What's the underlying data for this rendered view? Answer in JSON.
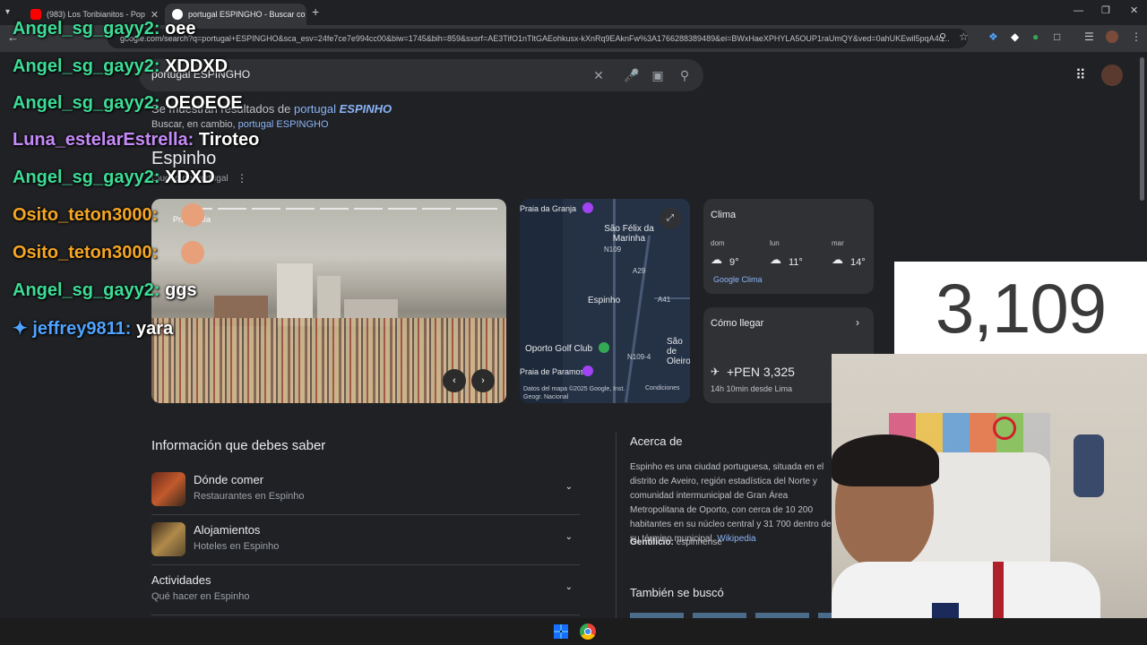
{
  "browser": {
    "tabs": [
      {
        "title": "(983) Los Toribianitos - Pop",
        "active": false
      },
      {
        "title": "portugal ESPINGHO - Buscar co",
        "active": true
      }
    ],
    "new_tab": "+",
    "url": "google.com/search?q=portugal+ESPINGHO&sca_esv=24fe7ce7e994cc00&biw=1745&bih=859&sxsrf=AE3TifO1nTltGAEohkusx-kXnRq9EAknFw%3A1766288389489&ei=BWxHaeXPHYLA5OUP1raUmQY&ved=0ahUKEwil5pqA4c..."
  },
  "search": {
    "query": "portugal ESPINGHO"
  },
  "correction": {
    "prefix": "Se muestran resultados de",
    "term_plain": "portugal",
    "term_bold": "ESPINHO",
    "instead_prefix": "Buscar, en cambio,",
    "instead_link": "portugal ESPINGHO"
  },
  "entity": {
    "title": "Espinho",
    "subtitle": "Ciudad de Portugal"
  },
  "photo": {
    "caption": "Praia Baía"
  },
  "map": {
    "labels": [
      "Praia da Granja",
      "São Félix da Marinha",
      "Espinho",
      "Oporto Golf Club",
      "Praia de Paramos",
      "São de Oleiros"
    ],
    "roads": [
      "N109",
      "A29",
      "A41",
      "N109-4"
    ],
    "credit": "Datos del mapa ©2025 Google, Inst. Geogr. Nacional",
    "terms": "Condiciones"
  },
  "weather": {
    "title": "Clima",
    "days": [
      {
        "day": "dom",
        "temp": "9°"
      },
      {
        "day": "lun",
        "temp": "11°"
      },
      {
        "day": "mar",
        "temp": "14°"
      }
    ],
    "source": "Google Clima"
  },
  "directions": {
    "title": "Cómo llegar",
    "price": "+PEN 3,325",
    "duration": "14h 10min desde Lima"
  },
  "info": {
    "title": "Información que debes saber",
    "rows": [
      {
        "title": "Dónde comer",
        "subtitle": "Restaurantes en Espinho"
      },
      {
        "title": "Alojamientos",
        "subtitle": "Hoteles en Espinho"
      },
      {
        "title": "Actividades",
        "subtitle": "Qué hacer en Espinho"
      }
    ]
  },
  "about": {
    "title": "Acerca de",
    "body": "Espinho es una ciudad portuguesa, situada en el distrito de Aveiro, región estadística del Norte y comunidad intermunicipal de Gran Área Metropolitana de Oporto, con cerca de 10 200 habitantes en su núcleo central y 31 700 dentro de su término municipal.",
    "link": "Wikipedia",
    "gent_label": "Gentilicio:",
    "gent_value": "espinhense",
    "also": "También se buscó"
  },
  "chat": [
    {
      "user": "Angel_sg_gayy2:",
      "msg": "oee",
      "color": "#3ddc97"
    },
    {
      "user": "Angel_sg_gayy2:",
      "msg": "XDDXD",
      "color": "#3ddc97"
    },
    {
      "user": "Angel_sg_gayy2:",
      "msg": "OEOEOE",
      "color": "#3ddc97"
    },
    {
      "user": "Luna_estelarEstrella:",
      "msg": "Tiroteo",
      "color": "#c58af9"
    },
    {
      "user": "Angel_sg_gayy2:",
      "msg": "XDXD",
      "color": "#3ddc97"
    },
    {
      "user": "Osito_teton3000:",
      "msg": "",
      "color": "#f5a623"
    },
    {
      "user": "Osito_teton3000:",
      "msg": "",
      "color": "#f5a623"
    },
    {
      "user": "Angel_sg_gayy2:",
      "msg": "ggs",
      "color": "#3ddc97"
    },
    {
      "user": "jeffrey9811:",
      "msg": "yara",
      "color": "#4fa3ff"
    }
  ],
  "counter": "3,109",
  "colors": {
    "accent_link": "#8ab4f8",
    "page_bg": "#202124",
    "card_bg": "#303134"
  }
}
